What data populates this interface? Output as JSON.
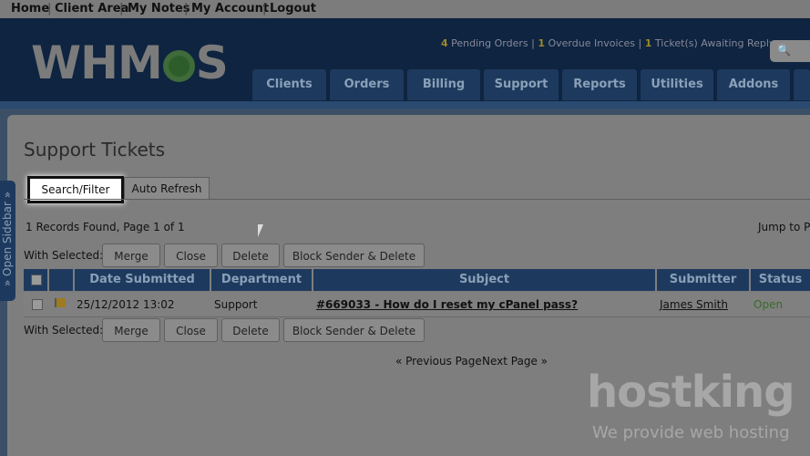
{
  "topnav": {
    "home": "Home",
    "client_area": "Client Area",
    "my_notes": "My Notes",
    "my_account": "My Account",
    "logout": "Logout",
    "sep": "|"
  },
  "brand": {
    "logo_text_left": "WHM",
    "logo_text_right": "S"
  },
  "status": {
    "pending_count": "4",
    "pending_label": "Pending Orders",
    "overdue_count": "1",
    "overdue_label": "Overdue Invoices",
    "tickets_count": "1",
    "tickets_label": "Ticket(s) Awaiting Reply",
    "sep": "|"
  },
  "search": {
    "icon": "search-icon"
  },
  "main_tabs": [
    "Clients",
    "Orders",
    "Billing",
    "Support",
    "Reports",
    "Utilities",
    "Addons"
  ],
  "sidebar": {
    "label": "» Open Sidebar »"
  },
  "page": {
    "title": "Support Tickets",
    "subtabs": [
      "Search/Filter",
      "Auto Refresh"
    ],
    "records": "1 Records Found, Page 1 of 1",
    "jump": "Jump to P"
  },
  "actions": {
    "with_selected": "With Selected:",
    "merge": "Merge",
    "close": "Close",
    "delete": "Delete",
    "block": "Block Sender & Delete"
  },
  "table": {
    "headers": {
      "date": "Date Submitted",
      "department": "Department",
      "subject": "Subject",
      "submitter": "Submitter",
      "status": "Status"
    },
    "rows": [
      {
        "date": "25/12/2012 13:02",
        "department": "Support",
        "subject": "#669033 - How do I reset my cPanel pass?",
        "submitter": "James Smith",
        "status": "Open"
      }
    ]
  },
  "pager": {
    "prev": "« Previous Page",
    "next": "Next Page »"
  },
  "watermark": {
    "brand": "hostking",
    "tagline": "We provide web hosting"
  },
  "colors": {
    "header_bg": "#0e2440",
    "tab_bg": "#1d3a5e",
    "status_open": "#3a6a2a"
  }
}
